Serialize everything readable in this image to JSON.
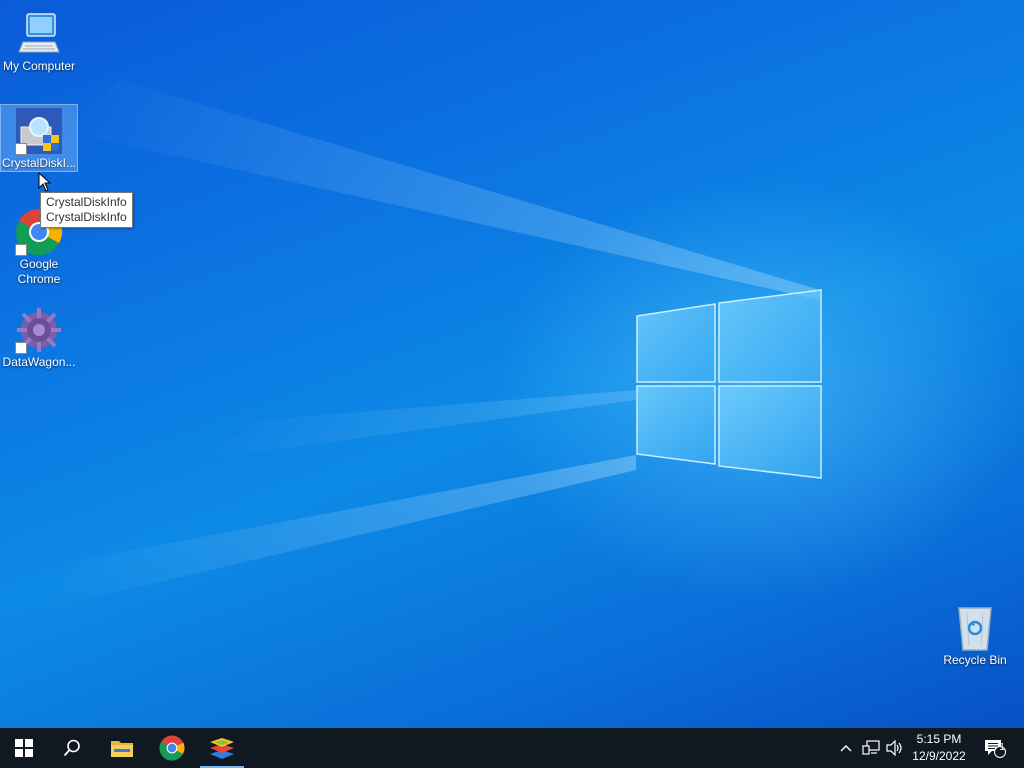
{
  "desktop": {
    "icons": [
      {
        "label": "My Computer",
        "icon": "computer-icon"
      },
      {
        "label": "CrystalDiskI...",
        "icon": "crystaldiskinfo-icon"
      },
      {
        "label": "Google Chrome",
        "icon": "chrome-icon"
      },
      {
        "label": "DataWagon...",
        "icon": "datawagon-icon"
      },
      {
        "label": "Recycle Bin",
        "icon": "recycle-bin-icon"
      }
    ],
    "tooltip": {
      "line1": "CrystalDiskInfo",
      "line2": "CrystalDiskInfo"
    }
  },
  "taskbar": {
    "buttons": [
      {
        "name": "start",
        "icon": "windows-logo-icon"
      },
      {
        "name": "search",
        "icon": "search-icon"
      },
      {
        "name": "file-explorer",
        "icon": "folder-icon"
      },
      {
        "name": "chrome",
        "icon": "chrome-icon"
      },
      {
        "name": "bluestacks",
        "icon": "bluestacks-icon"
      }
    ],
    "tray": {
      "icons": [
        "chevron-up-icon",
        "network-icon",
        "volume-icon"
      ],
      "time": "5:15 PM",
      "date": "12/9/2022",
      "notification_count": "1"
    }
  },
  "colors": {
    "taskbar": "#101822",
    "accent": "#7ab4f0"
  }
}
